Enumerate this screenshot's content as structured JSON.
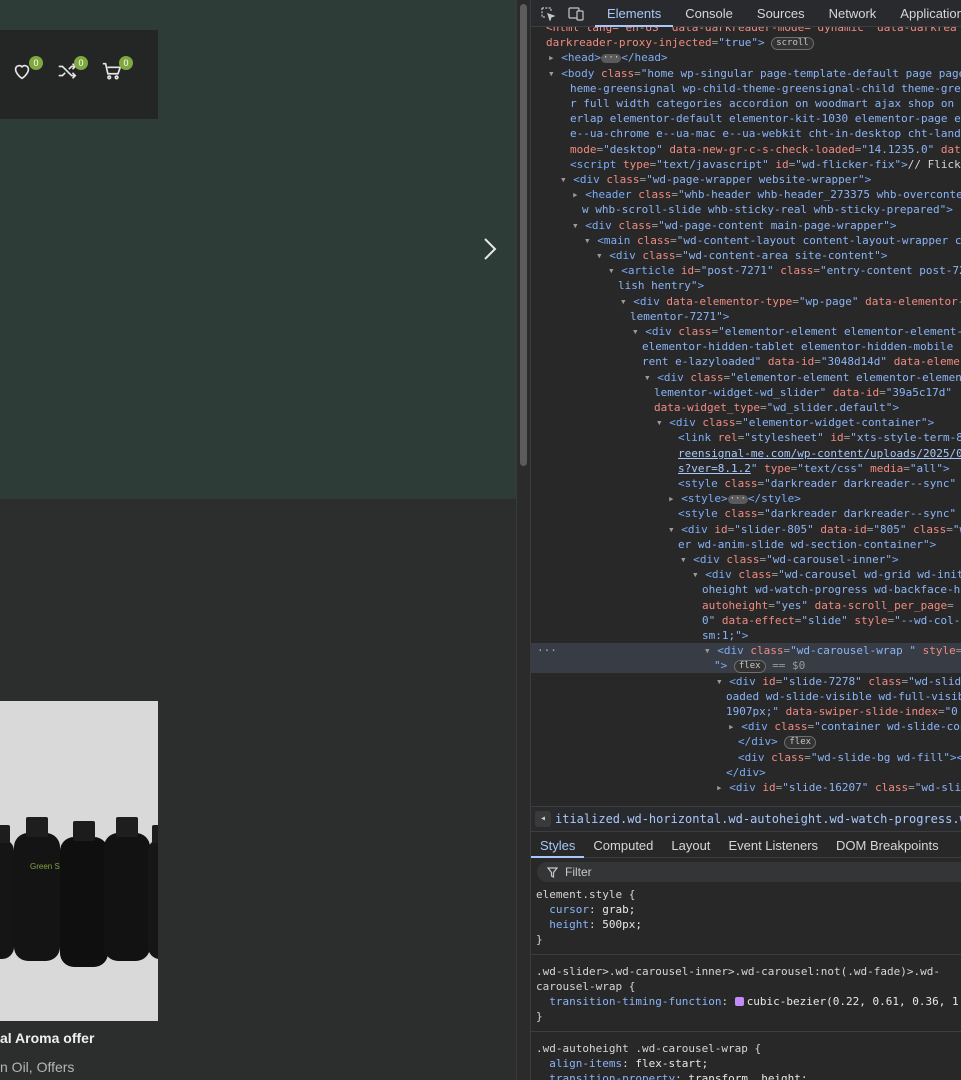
{
  "page": {
    "header": {
      "wishlist_count": "0",
      "compare_count": "0",
      "cart_count": "0"
    },
    "product": {
      "title": "al Aroma offer",
      "categories": "n Oil, Offers"
    },
    "bottle_label": "Green Signal"
  },
  "devtools": {
    "tabs": [
      "Elements",
      "Console",
      "Sources",
      "Network",
      "Application"
    ],
    "active_tab": "Elements",
    "dom_lines": [
      {
        "indent": 0,
        "tri": "",
        "html": "<span class='t-attr'>&lt;html lang=\"en-US\" data-darkreader-mode=\"dynamic\" data-darkrea</span>"
      },
      {
        "indent": 0,
        "tri": "",
        "html": "<span class='t-attr'>darkreader-proxy-injected</span><span class='t-eq'>=</span><span class='t-val2'>\"true\"</span><span class='t-tag'>&gt;</span> <span class='pill'>scroll</span>"
      },
      {
        "indent": 1,
        "tri": "▸",
        "html": "<span class='t-tag'>&lt;head&gt;</span><span class='ellipsis-pill'>···</span><span class='t-tag'>&lt;/head&gt;</span>"
      },
      {
        "indent": 1,
        "tri": "▾",
        "html": "<span class='t-tag'>&lt;body</span> <span class='t-attr'>class</span><span class='t-eq'>=</span><span class='t-val2'>\"home wp-singular page-template-default page page</span>"
      },
      {
        "indent": 2,
        "tri": "",
        "html": "<span class='t-val2'>heme-greensignal wp-child-theme-greensignal-child theme-green</span>"
      },
      {
        "indent": 2,
        "tri": "",
        "html": "<span class='t-val2'>r full width categories accordion on woodmart ajax shop on st</span>"
      },
      {
        "indent": 2,
        "tri": "",
        "html": "<span class='t-val2'>erlap elementor-default elementor-kit-1030 elementor-page ele</span>"
      },
      {
        "indent": 2,
        "tri": "",
        "html": "<span class='t-val2'>e--ua-chrome e--ua-mac e--ua-webkit cht-in-desktop cht-landsc</span>"
      },
      {
        "indent": 2,
        "tri": "",
        "html": "<span class='t-attr'>mode</span><span class='t-eq'>=</span><span class='t-val2'>\"desktop\"</span> <span class='t-attr'>data-new-gr-c-s-check-loaded</span><span class='t-eq'>=</span><span class='t-val2'>\"14.1235.0\"</span> <span class='t-attr'>data-</span>"
      },
      {
        "indent": 2,
        "tri": " ",
        "html": "<span class='t-tag'>&lt;script</span> <span class='t-attr'>type</span><span class='t-eq'>=</span><span class='t-val2'>\"text/javascript\"</span> <span class='t-attr'>id</span><span class='t-eq'>=</span><span class='t-val2'>\"wd-flicker-fix\"</span><span class='t-tag'>&gt;</span><span class='t-txt'>// Flick</span>"
      },
      {
        "indent": 2,
        "tri": "▾",
        "html": "<span class='t-tag'>&lt;div</span> <span class='t-attr'>class</span><span class='t-eq'>=</span><span class='t-val2'>\"wd-page-wrapper website-wrapper\"</span><span class='t-tag'>&gt;</span>"
      },
      {
        "indent": 3,
        "tri": "▸",
        "html": "<span class='t-tag'>&lt;header</span> <span class='t-attr'>class</span><span class='t-eq'>=</span><span class='t-val2'>\"whb-header whb-header_273375 whb-overconte</span>"
      },
      {
        "indent": 3,
        "tri": "",
        "html": "<span class='t-val2'>w whb-scroll-slide whb-sticky-real whb-sticky-prepared\"</span><span class='t-tag'>&gt;</span>"
      },
      {
        "indent": 3,
        "tri": "▾",
        "html": "<span class='t-tag'>&lt;div</span> <span class='t-attr'>class</span><span class='t-eq'>=</span><span class='t-val2'>\"wd-page-content main-page-wrapper\"</span><span class='t-tag'>&gt;</span>"
      },
      {
        "indent": 4,
        "tri": "▾",
        "html": "<span class='t-tag'>&lt;main</span> <span class='t-attr'>class</span><span class='t-eq'>=</span><span class='t-val2'>\"wd-content-layout content-layout-wrapper c</span>"
      },
      {
        "indent": 5,
        "tri": "▾",
        "html": "<span class='t-tag'>&lt;div</span> <span class='t-attr'>class</span><span class='t-eq'>=</span><span class='t-val2'>\"wd-content-area site-content\"</span><span class='t-tag'>&gt;</span>"
      },
      {
        "indent": 6,
        "tri": "▾",
        "html": "<span class='t-tag'>&lt;article</span> <span class='t-attr'>id</span><span class='t-eq'>=</span><span class='t-val2'>\"post-7271\"</span> <span class='t-attr'>class</span><span class='t-eq'>=</span><span class='t-val2'>\"entry-content post-72</span>"
      },
      {
        "indent": 6,
        "tri": "",
        "html": "<span class='t-val2'>lish hentry\"</span><span class='t-tag'>&gt;</span>"
      },
      {
        "indent": 7,
        "tri": "▾",
        "html": "<span class='t-tag'>&lt;div</span> <span class='t-attr'>data-elementor-type</span><span class='t-eq'>=</span><span class='t-val2'>\"wp-page\"</span> <span class='t-attr'>data-elementor-</span>"
      },
      {
        "indent": 7,
        "tri": "",
        "html": "<span class='t-val2'>lementor-7271\"</span><span class='t-tag'>&gt;</span>"
      },
      {
        "indent": 8,
        "tri": "▾",
        "html": "<span class='t-tag'>&lt;div</span> <span class='t-attr'>class</span><span class='t-eq'>=</span><span class='t-val2'>\"elementor-element elementor-element-</span>"
      },
      {
        "indent": 8,
        "tri": "",
        "html": "<span class='t-val2'>elementor-hidden-tablet elementor-hidden-mobile</span>"
      },
      {
        "indent": 8,
        "tri": "",
        "html": "<span class='t-val2'>rent e-lazyloaded\"</span> <span class='t-attr'>data-id</span><span class='t-eq'>=</span><span class='t-val2'>\"3048d14d\"</span> <span class='t-attr'>data-eleme</span>"
      },
      {
        "indent": 9,
        "tri": "▾",
        "html": "<span class='t-tag'>&lt;div</span> <span class='t-attr'>class</span><span class='t-eq'>=</span><span class='t-val2'>\"elementor-element elementor-elemen</span>"
      },
      {
        "indent": 9,
        "tri": "",
        "html": "<span class='t-val2'>lementor-widget-wd_slider\"</span> <span class='t-attr'>data-id</span><span class='t-eq'>=</span><span class='t-val2'>\"39a5c17d\"</span>"
      },
      {
        "indent": 9,
        "tri": "",
        "html": "<span class='t-attr'>data-widget_type</span><span class='t-eq'>=</span><span class='t-val2'>\"wd_slider.default\"</span><span class='t-tag'>&gt;</span>"
      },
      {
        "indent": 10,
        "tri": "▾",
        "html": "<span class='t-tag'>&lt;div</span> <span class='t-attr'>class</span><span class='t-eq'>=</span><span class='t-val2'>\"elementor-widget-container\"</span><span class='t-tag'>&gt;</span>"
      },
      {
        "indent": 11,
        "tri": "",
        "html": "<span class='t-tag'>&lt;link</span> <span class='t-attr'>rel</span><span class='t-eq'>=</span><span class='t-val2'>\"stylesheet\"</span> <span class='t-attr'>id</span><span class='t-eq'>=</span><span class='t-val2'>\"xts-style-term-8</span>"
      },
      {
        "indent": 11,
        "tri": "",
        "html": "<span class='t-link'>reensignal-me.com/wp-content/uploads/2025/0</span>"
      },
      {
        "indent": 11,
        "tri": "",
        "html": "<span class='t-link'>s?ver=8.1.2</span><span class='t-val2'>\"</span> <span class='t-attr'>type</span><span class='t-eq'>=</span><span class='t-val2'>\"text/css\"</span> <span class='t-attr'>media</span><span class='t-eq'>=</span><span class='t-val2'>\"all\"</span><span class='t-tag'>&gt;</span>"
      },
      {
        "indent": 11,
        "tri": "",
        "html": "<span class='t-tag'>&lt;style</span> <span class='t-attr'>class</span><span class='t-eq'>=</span><span class='t-val2'>\"darkreader darkreader--sync\"</span>"
      },
      {
        "indent": 11,
        "tri": "▸",
        "html": "<span class='t-tag'>&lt;style&gt;</span><span class='ellipsis-pill'>···</span><span class='t-tag'>&lt;/style&gt;</span>"
      },
      {
        "indent": 11,
        "tri": "",
        "html": "<span class='t-tag'>&lt;style</span> <span class='t-attr'>class</span><span class='t-eq'>=</span><span class='t-val2'>\"darkreader darkreader--sync\"</span>"
      },
      {
        "indent": 11,
        "tri": "▾",
        "html": "<span class='t-tag'>&lt;div</span> <span class='t-attr'>id</span><span class='t-eq'>=</span><span class='t-val2'>\"slider-805\"</span> <span class='t-attr'>data-id</span><span class='t-eq'>=</span><span class='t-val2'>\"805\"</span> <span class='t-attr'>class</span><span class='t-eq'>=</span><span class='t-val2'>\"w</span>"
      },
      {
        "indent": 11,
        "tri": "",
        "html": "<span class='t-val2'>er wd-anim-slide wd-section-container\"</span><span class='t-tag'>&gt;</span>"
      },
      {
        "indent": 12,
        "tri": "▾",
        "html": "<span class='t-tag'>&lt;div</span> <span class='t-attr'>class</span><span class='t-eq'>=</span><span class='t-val2'>\"wd-carousel-inner\"</span><span class='t-tag'>&gt;</span>"
      },
      {
        "indent": 13,
        "tri": "▾",
        "html": "<span class='t-tag'>&lt;div</span> <span class='t-attr'>class</span><span class='t-eq'>=</span><span class='t-val2'>\"wd-carousel wd-grid wd-init</span>"
      },
      {
        "indent": 13,
        "tri": "",
        "html": "<span class='t-val2'>oheight wd-watch-progress wd-backface-h</span>"
      },
      {
        "indent": 13,
        "tri": "",
        "html": "<span class='t-attr'>autoheight</span><span class='t-eq'>=</span><span class='t-val2'>\"yes\"</span> <span class='t-attr'>data-scroll_per_page</span><span class='t-eq'>=</span>"
      },
      {
        "indent": 13,
        "tri": "",
        "html": "<span class='t-val2'>0\"</span> <span class='t-attr'>data-effect</span><span class='t-eq'>=</span><span class='t-val2'>\"slide\"</span> <span class='t-attr'>style</span><span class='t-eq'>=</span><span class='t-val2'>\"--wd-col-</span>"
      },
      {
        "indent": 13,
        "tri": "",
        "html": "<span class='t-val2'>sm:1;\"</span><span class='t-tag'>&gt;</span>"
      },
      {
        "indent": 14,
        "tri": "▾",
        "selected": true,
        "html": "<span class='t-tag'>&lt;div</span> <span class='t-attr'>class</span><span class='t-eq'>=</span><span class='t-val2'>\"wd-carousel-wrap \"</span> <span class='t-attr'>style</span><span class='t-eq'>=</span>"
      },
      {
        "indent": 14,
        "tri": "",
        "selected": true,
        "html": "<span class='t-val2'>\"</span><span class='t-tag'>&gt;</span> <span class='pill'>flex</span> <span class='t-eq'>== $0</span>"
      },
      {
        "indent": 15,
        "tri": "▾",
        "html": "<span class='t-tag'>&lt;div</span> <span class='t-attr'>id</span><span class='t-eq'>=</span><span class='t-val2'>\"slide-7278\"</span> <span class='t-attr'>class</span><span class='t-eq'>=</span><span class='t-val2'>\"wd-slide</span>"
      },
      {
        "indent": 15,
        "tri": "",
        "html": "<span class='t-val2'>oaded wd-slide-visible wd-full-visib</span>"
      },
      {
        "indent": 15,
        "tri": "",
        "html": "<span class='t-val2'>1907px;\"</span> <span class='t-attr'>data-swiper-slide-index</span><span class='t-eq'>=</span><span class='t-val2'>\"0</span>"
      },
      {
        "indent": 16,
        "tri": "▸",
        "html": "<span class='t-tag'>&lt;div</span> <span class='t-attr'>class</span><span class='t-eq'>=</span><span class='t-val2'>\"container wd-slide-con</span>"
      },
      {
        "indent": 16,
        "tri": "",
        "html": "<span class='t-tag'>&lt;/div&gt;</span> <span class='pill'>flex</span>"
      },
      {
        "indent": 16,
        "tri": "",
        "html": "<span class='t-tag'>&lt;div</span> <span class='t-attr'>class</span><span class='t-eq'>=</span><span class='t-val2'>\"wd-slide-bg wd-fill\"</span><span class='t-tag'>&gt;&lt;</span>"
      },
      {
        "indent": 15,
        "tri": "",
        "html": "<span class='t-tag'>&lt;/div&gt;</span>"
      },
      {
        "indent": 15,
        "tri": "▸",
        "html": "<span class='t-tag'>&lt;div</span> <span class='t-attr'>id</span><span class='t-eq'>=</span><span class='t-val2'>\"slide-16207\"</span> <span class='t-attr'>class</span><span class='t-eq'>=</span><span class='t-val2'>\"wd-sli</span>"
      }
    ],
    "breadcrumb": "itialized.wd-horizontal.wd-autoheight.wd-watch-progress.wd-backface-h",
    "sub_tabs": [
      "Styles",
      "Computed",
      "Layout",
      "Event Listeners",
      "DOM Breakpoints"
    ],
    "active_sub_tab": "Styles",
    "filter_placeholder": "Filter",
    "rules": [
      {
        "selector": "element.style {",
        "props": [
          {
            "name": "cursor",
            "value": "grab;"
          },
          {
            "name": "height",
            "value": "500px;"
          }
        ],
        "close": "}"
      },
      {
        "selector": ".wd-slider>.wd-carousel-inner>.wd-carousel:not(.wd-fade)>.wd-",
        "selector2": "carousel-wrap {",
        "props": [
          {
            "name": "transition-timing-function",
            "value": "cubic-bezier(0.22, 0.61, 0.36, 1",
            "swatch": true
          }
        ],
        "close": "}"
      },
      {
        "selector": ".wd-autoheight .wd-carousel-wrap {",
        "props": [
          {
            "name": "align-items",
            "value": "flex-start;"
          },
          {
            "name": "transition-property",
            "value": "transform, height;"
          }
        ],
        "close": "}"
      }
    ]
  }
}
